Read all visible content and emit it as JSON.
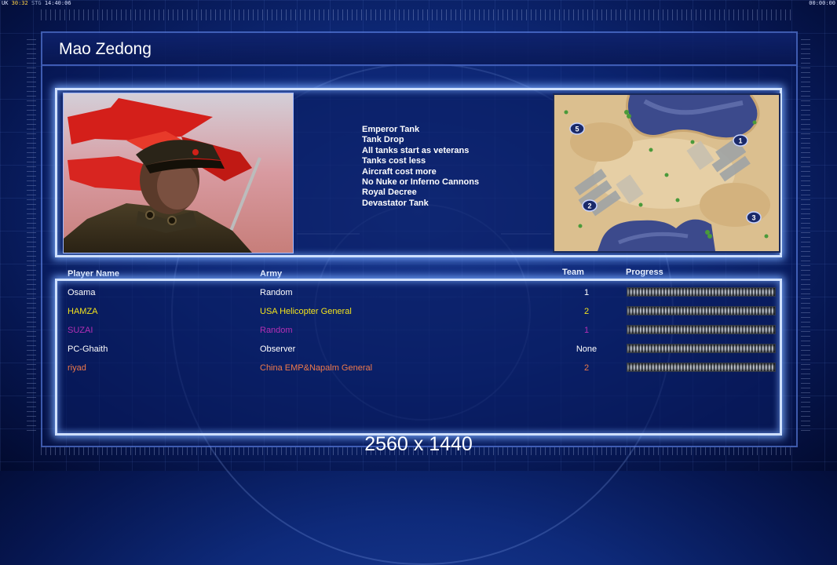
{
  "hud": {
    "left_prefix": "UK",
    "left_clock": "30:32",
    "left_sep": "STG",
    "left_time": "14:40:06",
    "right_time": "00:00:00"
  },
  "general": {
    "name": "Mao Zedong",
    "features": [
      "Emperor Tank",
      "Tank Drop",
      "All tanks start as veterans",
      "Tanks cost less",
      "Aircraft cost more",
      "No Nuke or Inferno Cannons",
      "Royal Decree",
      "Devastator Tank"
    ]
  },
  "minimap": {
    "start_positions": [
      "5",
      "1",
      "2",
      "3"
    ]
  },
  "players_table": {
    "headers": {
      "name": "Player Name",
      "army": "Army",
      "team": "Team",
      "progress": "Progress"
    },
    "rows": [
      {
        "name": "Osama",
        "army": "Random",
        "team": "1",
        "color": "#ffffff",
        "progress": 1.0
      },
      {
        "name": "HAMZA",
        "army": "USA Helicopter General",
        "team": "2",
        "color": "#f2e21c",
        "progress": 1.0
      },
      {
        "name": "SUZAI",
        "army": "Random",
        "team": "1",
        "color": "#b42fb4",
        "progress": 1.0
      },
      {
        "name": "PC-Ghaith",
        "army": "Observer",
        "team": "None",
        "color": "#ffffff",
        "progress": 1.0
      },
      {
        "name": "riyad",
        "army": "China EMP&Napalm General",
        "team": "2",
        "color": "#f07a4a",
        "progress": 1.0
      }
    ]
  },
  "resolution_label": "2560 x 1440"
}
